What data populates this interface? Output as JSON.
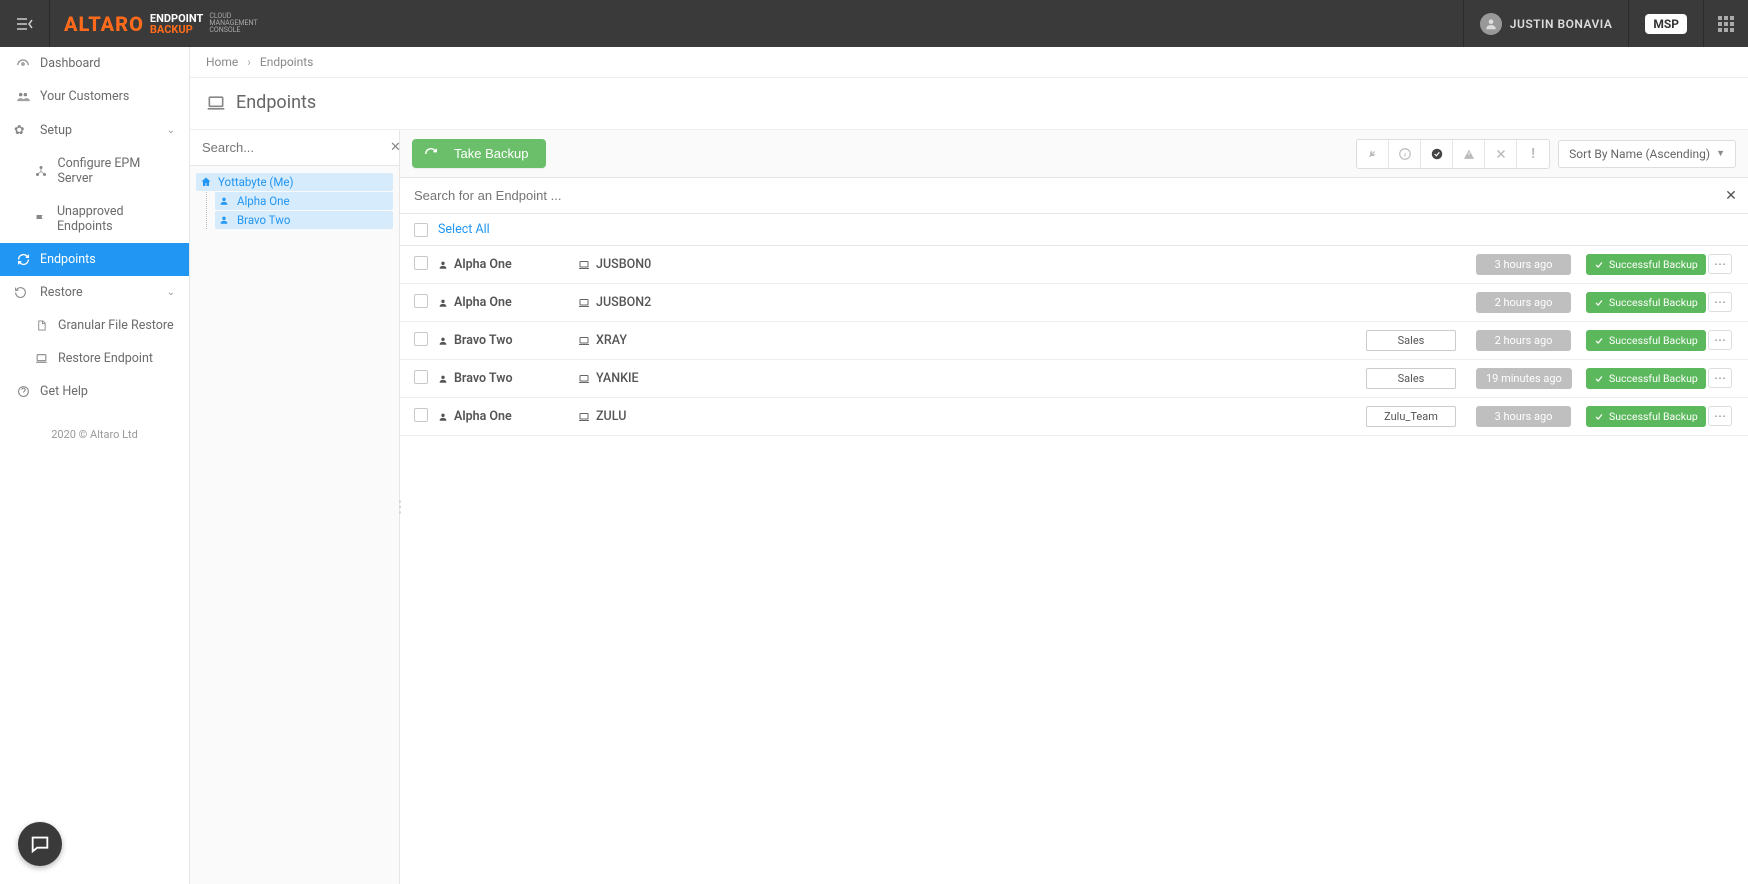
{
  "topbar": {
    "brand_main": "ALTARO",
    "brand_ep1": "ENDPOINT",
    "brand_ep2": "BACKUP",
    "brand_cloud": "CLOUD",
    "brand_mgmt": "MANAGEMENT",
    "brand_console": "CONSOLE",
    "user_name": "JUSTIN BONAVIA",
    "msp_badge": "MSP"
  },
  "sidebar": {
    "items": {
      "dashboard": "Dashboard",
      "customers": "Your Customers",
      "setup": "Setup",
      "configure_epm": "Configure EPM Server",
      "unapproved_ep": "Unapproved Endpoints",
      "endpoints": "Endpoints",
      "restore": "Restore",
      "granular": "Granular File Restore",
      "restore_ep": "Restore Endpoint",
      "help": "Get Help"
    },
    "footer": "2020  © Altaro Ltd"
  },
  "tree": {
    "search_placeholder": "Search...",
    "root": "Yottabyte (Me)",
    "children": [
      {
        "label": "Alpha One"
      },
      {
        "label": "Bravo Two"
      }
    ]
  },
  "breadcrumb": {
    "home": "Home",
    "current": "Endpoints"
  },
  "page_title": "Endpoints",
  "toolbar": {
    "take_backup": "Take Backup",
    "sort_label": "Sort By Name (Ascending)"
  },
  "search_endpoint_placeholder": "Search for an Endpoint ...",
  "select_all": "Select All",
  "rows": [
    {
      "customer": "Alpha One",
      "host": "JUSBON0",
      "tag": "",
      "time": "3 hours ago",
      "status": "Successful Backup"
    },
    {
      "customer": "Alpha One",
      "host": "JUSBON2",
      "tag": "",
      "time": "2 hours ago",
      "status": "Successful Backup"
    },
    {
      "customer": "Bravo Two",
      "host": "XRAY",
      "tag": "Sales",
      "time": "2 hours ago",
      "status": "Successful Backup"
    },
    {
      "customer": "Bravo Two",
      "host": "YANKIE",
      "tag": "Sales",
      "time": "19 minutes ago",
      "status": "Successful Backup"
    },
    {
      "customer": "Alpha One",
      "host": "ZULU",
      "tag": "Zulu_Team",
      "time": "3 hours ago",
      "status": "Successful Backup"
    }
  ]
}
